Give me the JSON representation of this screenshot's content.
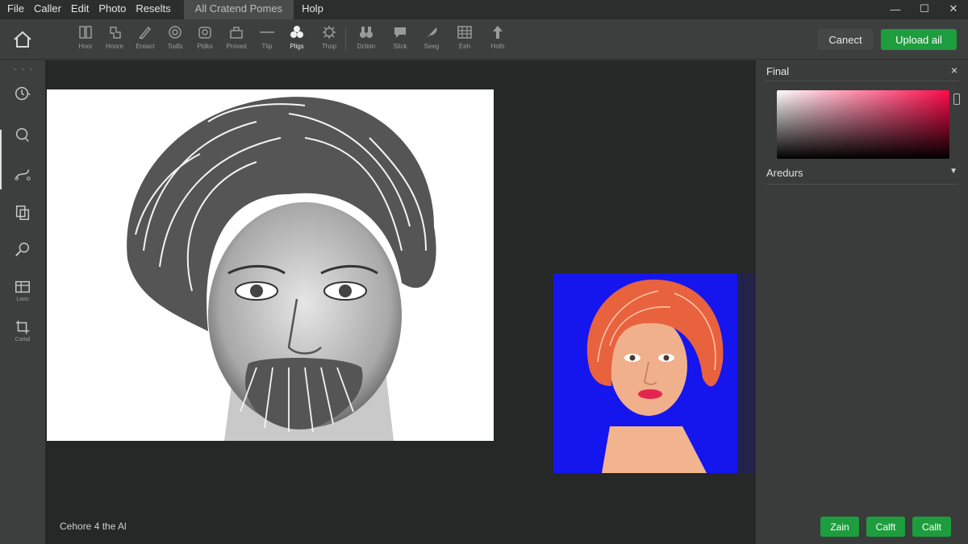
{
  "menu": {
    "items": [
      "File",
      "Caller",
      "Edit",
      "Photo",
      "Reselts"
    ],
    "active_tab": "All Cratend Pomes",
    "help": "Holp"
  },
  "window_controls": {
    "minimize": "—",
    "maximize": "☐",
    "close": "✕"
  },
  "toolbar": {
    "tools": [
      {
        "label": "Hoor",
        "icon": "columns-icon"
      },
      {
        "label": "Hoore",
        "icon": "clip-icon"
      },
      {
        "label": "Ereact",
        "icon": "brush-icon"
      },
      {
        "label": "Todls",
        "icon": "spiral-icon"
      },
      {
        "label": "Pldks",
        "icon": "camera-icon"
      },
      {
        "label": "Proved",
        "icon": "bag-icon"
      },
      {
        "label": "Tlip",
        "icon": "line-icon"
      },
      {
        "label": "Pligs",
        "icon": "blobs-icon"
      },
      {
        "label": "Thop",
        "icon": "gear-icon"
      },
      {
        "label": "Dclion",
        "icon": "binoculars-icon"
      },
      {
        "label": "Slick",
        "icon": "speech-icon"
      },
      {
        "label": "Seeg",
        "icon": "feather-icon"
      },
      {
        "label": "Eeh",
        "icon": "grid-icon"
      },
      {
        "label": "Hoth",
        "icon": "arrow-up-icon"
      }
    ],
    "cancel_label": "Canect",
    "upload_label": "Upload ail"
  },
  "sidebar": {
    "dots": "- - -",
    "tools": [
      {
        "icon": "history-icon",
        "label": ""
      },
      {
        "icon": "lasso-icon",
        "label": ""
      },
      {
        "icon": "path-icon",
        "label": ""
      },
      {
        "icon": "copy-icon",
        "label": ""
      },
      {
        "icon": "magnify-icon",
        "label": ""
      },
      {
        "icon": "layers-icon",
        "label": "Laos"
      },
      {
        "icon": "crop-icon",
        "label": "Cartal"
      }
    ]
  },
  "canvas": {
    "caption": "Cehore 4 the Al"
  },
  "panel": {
    "title": "Final",
    "close": "×",
    "section_label": "Aredurs",
    "section_chevron": "▼",
    "buttons": [
      "Zain",
      "Calft",
      "Callt"
    ]
  },
  "colors": {
    "accent_green": "#1e9d3e",
    "result_background": "#1515ee",
    "picker_hue": "#ff0a4a"
  }
}
